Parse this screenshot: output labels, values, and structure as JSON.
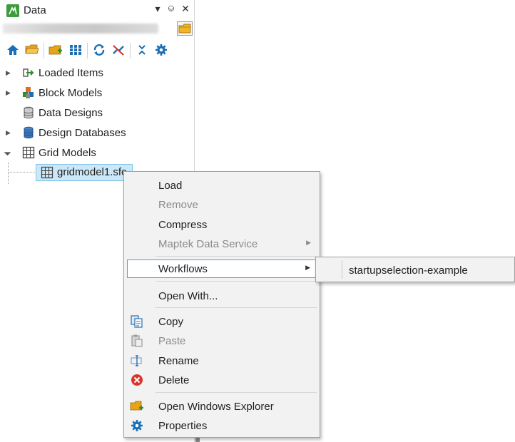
{
  "panel": {
    "title": "Data",
    "colors": {
      "accent": "#3d9c3d",
      "selection_bg": "#cce8f8",
      "selection_border": "#7ec4ea"
    }
  },
  "toolbar": {
    "icons": [
      "home-icon",
      "folder-open-icon",
      "add-folder-icon",
      "grid-view-icon",
      "refresh-icon",
      "disconnect-icon",
      "collapse-all-icon",
      "settings-icon"
    ]
  },
  "tree": {
    "items": [
      {
        "label": "Loaded Items",
        "expandable": true,
        "icon": "loaded-items-icon"
      },
      {
        "label": "Block Models",
        "expandable": true,
        "icon": "block-models-icon"
      },
      {
        "label": "Data Designs",
        "expandable": false,
        "icon": "database-icon"
      },
      {
        "label": "Design Databases",
        "expandable": true,
        "icon": "design-database-icon"
      },
      {
        "label": "Grid Models",
        "expandable": true,
        "expanded": true,
        "icon": "grid-icon"
      }
    ],
    "child": {
      "label": "gridmodel1.sfc",
      "icon": "grid-icon"
    }
  },
  "context_menu": {
    "items": [
      {
        "label": "Load",
        "enabled": true
      },
      {
        "label": "Remove",
        "enabled": false
      },
      {
        "label": "Compress",
        "enabled": true
      },
      {
        "label": "Maptek Data Service",
        "enabled": false,
        "submenu": true
      },
      {
        "label": "Workflows",
        "enabled": true,
        "submenu": true,
        "highlighted": true
      },
      {
        "label": "Open With...",
        "enabled": true
      },
      {
        "label": "Copy",
        "enabled": true,
        "icon": "copy-icon"
      },
      {
        "label": "Paste",
        "enabled": false,
        "icon": "paste-icon"
      },
      {
        "label": "Rename",
        "enabled": true,
        "icon": "rename-icon"
      },
      {
        "label": "Delete",
        "enabled": true,
        "icon": "delete-icon"
      },
      {
        "label": "Open Windows Explorer",
        "enabled": true,
        "icon": "explorer-folder-icon"
      },
      {
        "label": "Properties",
        "enabled": true,
        "icon": "properties-icon"
      }
    ]
  },
  "submenu": {
    "items": [
      {
        "label": "startupselection-example"
      }
    ]
  }
}
